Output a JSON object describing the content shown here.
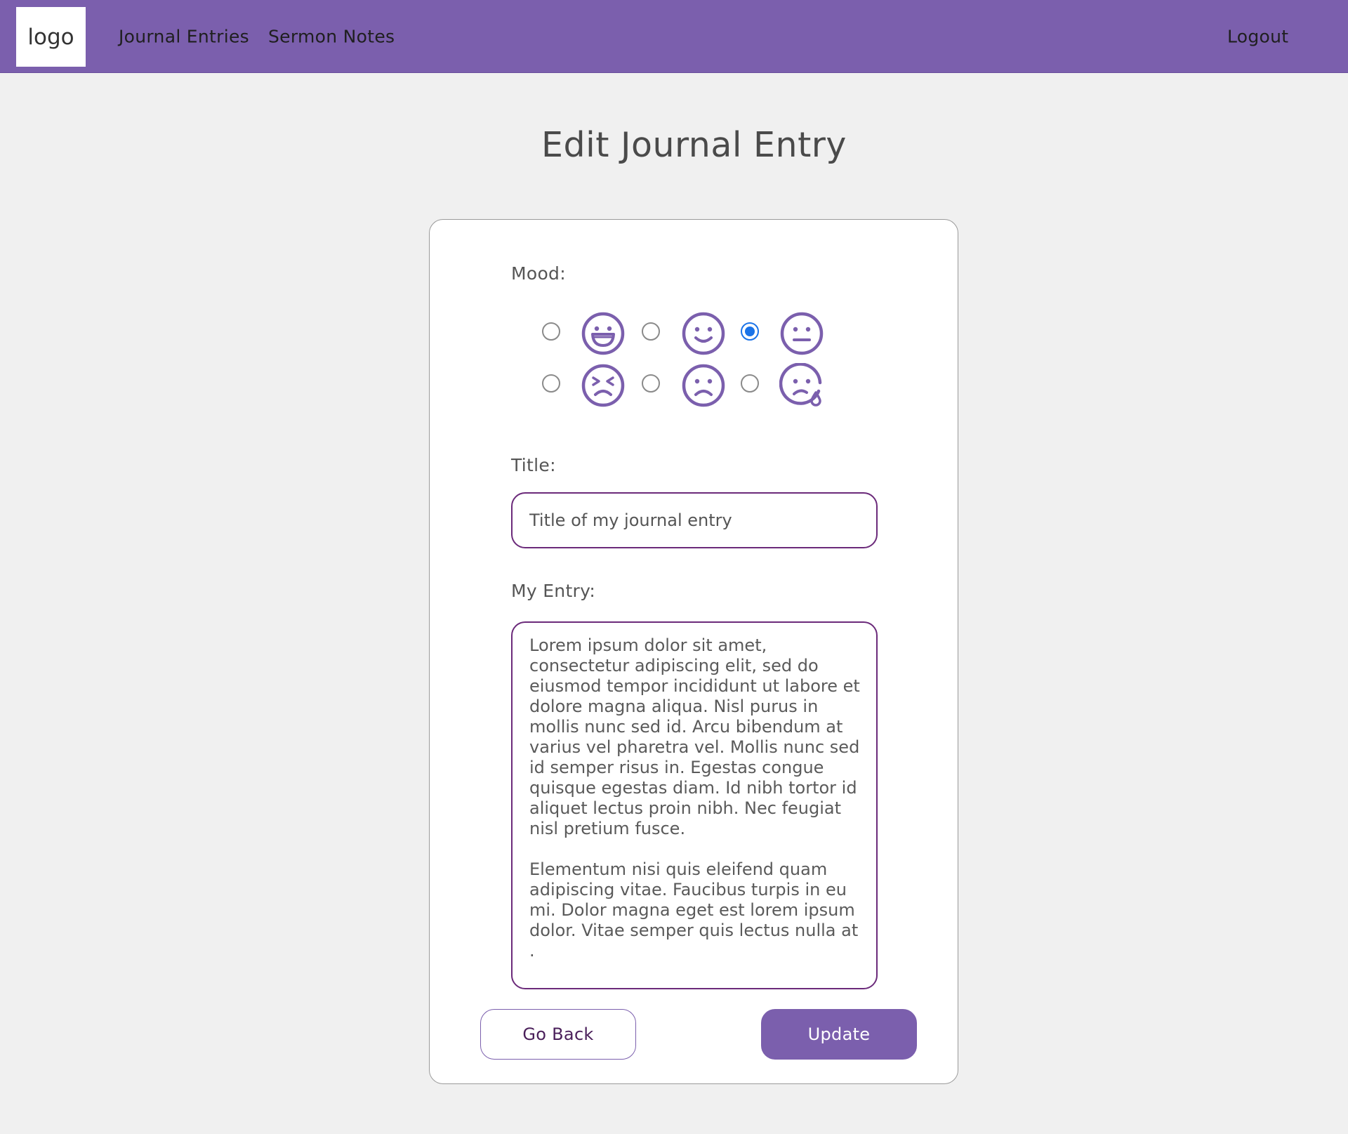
{
  "nav": {
    "logo": "logo",
    "links": [
      "Journal Entries",
      "Sermon Notes"
    ],
    "logout": "Logout"
  },
  "page": {
    "title": "Edit Journal Entry"
  },
  "form": {
    "mood_label": "Mood:",
    "moods": [
      {
        "icon": "laughing-face-icon",
        "selected": false
      },
      {
        "icon": "smiling-face-icon",
        "selected": false
      },
      {
        "icon": "neutral-face-icon",
        "selected": true
      },
      {
        "icon": "angry-face-icon",
        "selected": false
      },
      {
        "icon": "sad-face-icon",
        "selected": false
      },
      {
        "icon": "crying-face-icon",
        "selected": false
      }
    ],
    "title_label": "Title:",
    "title_placeholder": "Title of my journal entry",
    "entry_label": "My Entry:",
    "entry_paragraphs": [
      "Lorem ipsum dolor sit amet, consectetur adipiscing elit, sed do eiusmod tempor incididunt ut labore et dolore magna aliqua. Nisl purus in mollis nunc sed id. Arcu bibendum at varius vel pharetra vel. Mollis nunc sed id semper risus in. Egestas congue quisque egestas diam. Id nibh tortor id aliquet lectus proin nibh. Nec feugiat nisl pretium fusce.",
      "Elementum nisi quis eleifend quam adipiscing vitae. Faucibus turpis in eu mi. Dolor magna eget est lorem ipsum dolor. Vitae semper quis lectus nulla at ."
    ],
    "back_label": "Go Back",
    "update_label": "Update"
  },
  "colors": {
    "primary": "#7b5fad",
    "input_border": "#6b2a7a",
    "radio_selected": "#1a73e8",
    "background": "#f0f0f0"
  }
}
